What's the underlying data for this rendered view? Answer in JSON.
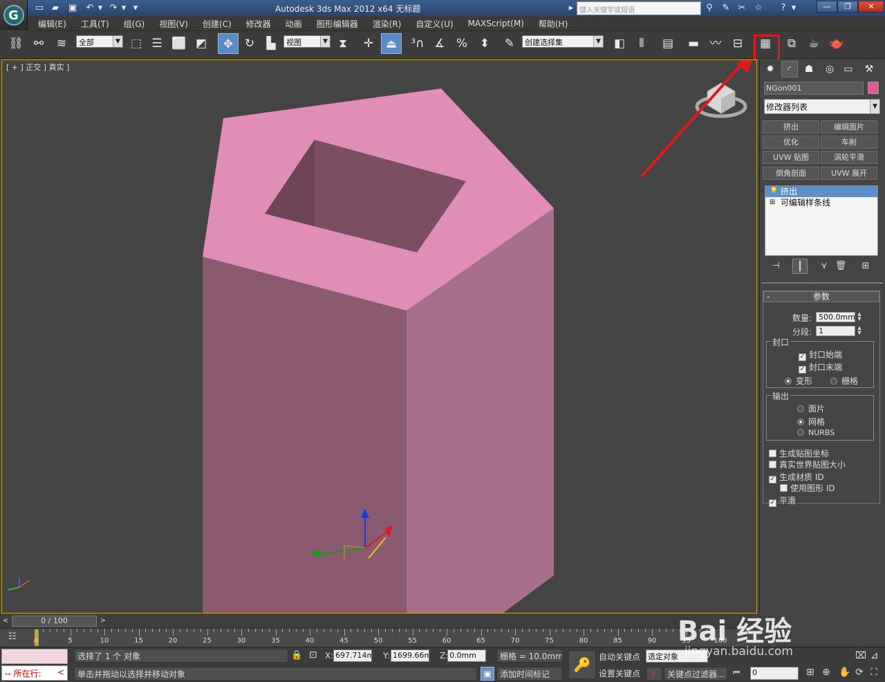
{
  "title_bar": {
    "app_title": "Autodesk 3ds Max  2012 x64     无标题",
    "search_placeholder": "键入关键字或短语"
  },
  "menu": [
    "编辑(E)",
    "工具(T)",
    "组(G)",
    "视图(V)",
    "创建(C)",
    "修改器",
    "动画",
    "图形编辑器",
    "渲染(R)",
    "自定义(U)",
    "MAXScript(M)",
    "帮助(H)"
  ],
  "toolbar": {
    "selection_filter": "全部",
    "reference_coord": "视图",
    "named_selection": "创建选择集"
  },
  "viewport": {
    "label": "[ + ] 正交 ] 真实 ]",
    "object_color": "#e08eb8",
    "side_left_color": "#8a5a70",
    "side_right_color": "#a86f8c",
    "inner_color": "#7c4e63"
  },
  "command_panel": {
    "object_name": "NGon001",
    "object_swatch": "#e05a98",
    "modifier_list": "修改器列表",
    "modifier_buttons": [
      "挤出",
      "编辑面片",
      "优化",
      "车削",
      "UVW 贴图",
      "涡轮平滑",
      "倒角剖面",
      "UVW 展开"
    ],
    "stack": [
      "挤出",
      "可编辑样条线"
    ],
    "rollout_title": "参数",
    "amount_label": "数量:",
    "amount_value": "500.0mm",
    "segments_label": "分段:",
    "segments_value": "1",
    "capping_group": "封口",
    "cap_start": "封口始端",
    "cap_end": "封口末端",
    "morph": "变形",
    "grid": "栅格",
    "output_group": "输出",
    "patch": "面片",
    "mesh": "网格",
    "nurbs": "NURBS",
    "gen_map_coords": "生成贴图坐标",
    "real_world": "真实世界贴图大小",
    "gen_mat_ids": "生成材质 ID",
    "use_shape_ids": "使用图形 ID",
    "smooth": "平滑"
  },
  "timeline": {
    "frame_counter": "0 / 100",
    "ticks": [
      "0",
      "5",
      "10",
      "15",
      "20",
      "25",
      "30",
      "35",
      "40",
      "45",
      "50",
      "55",
      "60",
      "65",
      "70",
      "75",
      "80",
      "85",
      "90",
      "95",
      "100"
    ]
  },
  "status_bar": {
    "mode_label": "所在行:",
    "selection_status": "选择了 1 个 对象",
    "prompt": "单击并拖动以选择并移动对象",
    "x_value": "697.714mm",
    "y_value": "1699.66mm",
    "z_value": "0.0mm",
    "grid": "栅格 = 10.0mm",
    "add_time_tag": "添加时间标记",
    "auto_key": "自动关键点",
    "set_key": "设置关键点",
    "selected_object": "选定对象",
    "key_filters": "关键点过滤器...",
    "frame_value": "0"
  },
  "watermark": {
    "brand": "Bai 经验",
    "url": "jingyan.baidu.com"
  },
  "annotation_color": "#e21818"
}
